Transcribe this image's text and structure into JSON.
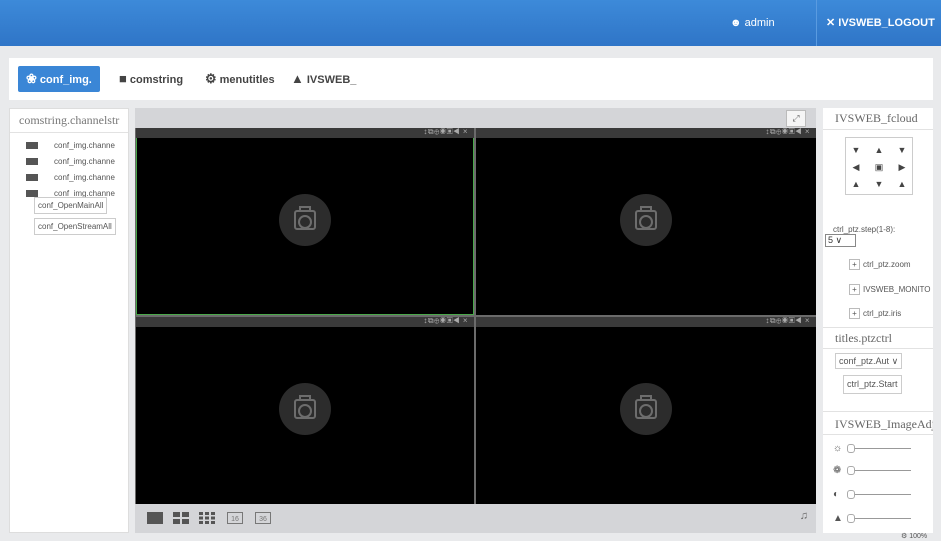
{
  "header": {
    "user": "admin",
    "logout": "IVSWEB_LOGOUT"
  },
  "tabs": [
    {
      "label": "conf_img.",
      "icon": "camera-settings-icon"
    },
    {
      "label": "comstring",
      "icon": "group-icon"
    },
    {
      "label": "menutitles",
      "icon": "gear-icon"
    },
    {
      "label": "IVSWEB_",
      "icon": "bell-icon"
    }
  ],
  "channels": {
    "title": "comstring.channelstr",
    "items": [
      "conf_img.channe",
      "conf_img.channe",
      "conf_img.channe",
      "conf_img.channe"
    ],
    "open_main_all": "conf_OpenMainAll",
    "open_stream_all": "conf_OpenStreamAll"
  },
  "video": {
    "pane_tools": "↕⧉⊕◉▣◀ ×",
    "layouts": [
      "1x1",
      "2x2",
      "3x3",
      "16",
      "36"
    ]
  },
  "ptz": {
    "title": "IVSWEB_fcloud",
    "step_label": "ctrl_ptz.step(1-8):",
    "step_value": "5",
    "rows": [
      "ctrl_ptz.zoom",
      "IVSWEB_MONITO",
      "ctrl_ptz.iris"
    ]
  },
  "ptzctrl": {
    "title": "titles.ptzctrl",
    "select": "conf_ptz.Aut",
    "start": "ctrl_ptz.Start"
  },
  "image_adjust": {
    "title": "IVSWEB_ImageAdjus",
    "sliders": [
      "brightness-icon",
      "palette-icon",
      "contrast-icon",
      "saturation-icon"
    ]
  },
  "zoom_level": "100%"
}
